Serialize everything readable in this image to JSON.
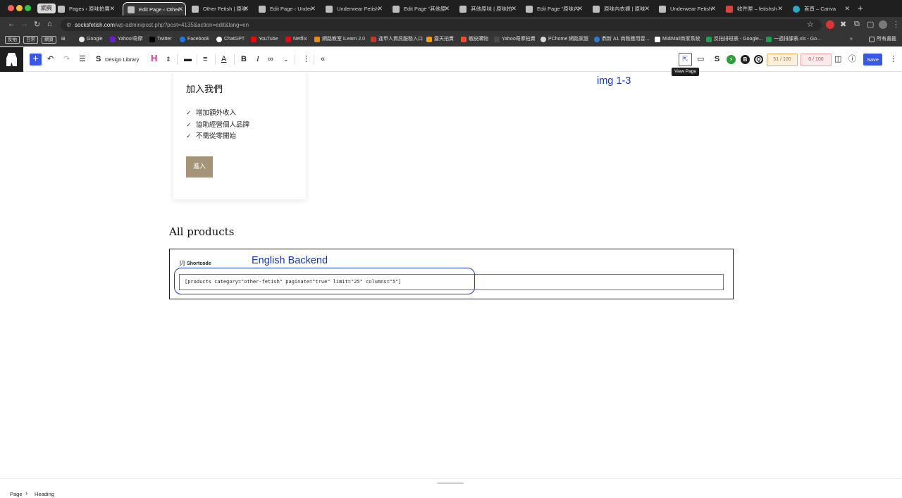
{
  "browser": {
    "tab_group_label": "網頁",
    "tabs": [
      {
        "title": "Pages ‹ 原味拍賣",
        "active": false
      },
      {
        "title": "Edit Page ‹ Other",
        "active": true
      },
      {
        "title": "Other Fetish | 原味",
        "active": false
      },
      {
        "title": "Edit Page ‹ Under",
        "active": false
      },
      {
        "title": "Underwear Fetish",
        "active": false
      },
      {
        "title": "Edit Page “其他原",
        "active": false
      },
      {
        "title": "其他原味 | 原味拍",
        "active": false
      },
      {
        "title": "Edit Page “原味內",
        "active": false
      },
      {
        "title": "原味內衣褲 | 原味",
        "active": false
      },
      {
        "title": "Underwear Fetish",
        "active": false
      },
      {
        "title": "收件匣 – fetishsh",
        "active": false
      },
      {
        "title": "首頁 – Canva",
        "active": false
      }
    ],
    "new_tab": "+",
    "url_domain": "socksfetish.com",
    "url_path": "/wp-admin/post.php?post=4135&action=edit&lang=en",
    "bookmark_folders": [
      "反拍",
      "日常",
      "網頁"
    ],
    "bookmarks": [
      "Google",
      "Yahoo!奇摩",
      "Twitter",
      "Facebook",
      "ChatGPT",
      "YouTube",
      "Netflix",
      "網路教室 iLearn 2.0",
      "逢甲人資訊服務入口",
      "露天拍賣",
      "蝦皮購物",
      "Yahoo奇摩拍賣",
      "PChome 網路家庭",
      "鼎新 A1 商務應用雲...",
      "MidiMall商家系統",
      "反拍排班表 - Google...",
      "一週排課表.xls - Go..."
    ],
    "bookmarks_more": "»",
    "all_bookmarks": "所有書籤"
  },
  "editor": {
    "design_library": "Design Library",
    "heading_icon": "H",
    "view_page_tooltip": "View Page",
    "score_a": "51 / 100",
    "score_b": "0 / 100",
    "save_label": "Save"
  },
  "canvas": {
    "join_title": "加入我們",
    "join_items": [
      "增加額外收入",
      "協助經營個人品牌",
      "不需從零開始"
    ],
    "enter_button": "進入",
    "annotation_img": "img 1-3",
    "all_products_heading": "All products",
    "shortcode_icon": "[/]",
    "shortcode_label": "Shortcode",
    "annotation_backend": "English Backend",
    "shortcode_value": "[products category=\"other-fetish\" paginate=\"true\" limit=\"25\" columns=\"5\"]"
  },
  "footer": {
    "breadcrumb": [
      "Page",
      "Heading"
    ]
  },
  "colors": {
    "wp_blue": "#3858e9",
    "annotation_blue": "#1431c9",
    "join_button": "#a69479",
    "heading_pink": "#d63384"
  }
}
